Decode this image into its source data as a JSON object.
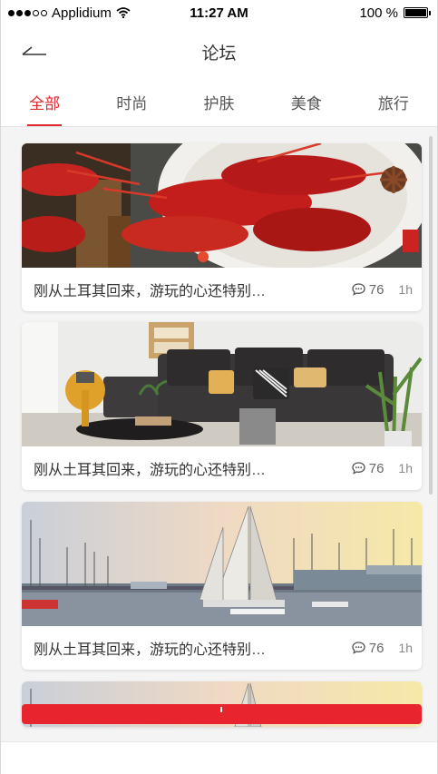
{
  "status_bar": {
    "carrier": "Applidium",
    "time": "11:27 AM",
    "battery": "100 %",
    "icons": [
      "signal-dots-icon",
      "wifi-icon",
      "battery-icon"
    ]
  },
  "nav": {
    "title": "论坛",
    "back_icon": "back-arrow-icon"
  },
  "tabs": [
    {
      "label": "全部",
      "active": true
    },
    {
      "label": "时尚",
      "active": false
    },
    {
      "label": "护肤",
      "active": false
    },
    {
      "label": "美食",
      "active": false
    },
    {
      "label": "旅行",
      "active": false
    }
  ],
  "posts": [
    {
      "title": "刚从土耳其回来，游玩的心还特别…",
      "comments": "76",
      "time": "1h",
      "image": "crayfish-dish-photo"
    },
    {
      "title": "刚从土耳其回来，游玩的心还特别…",
      "comments": "76",
      "time": "1h",
      "image": "living-room-sofa-photo"
    },
    {
      "title": "刚从土耳其回来，游玩的心还特别…",
      "comments": "76",
      "time": "1h",
      "image": "sailboat-harbor-photo"
    }
  ],
  "colors": {
    "accent": "#e0282f",
    "cta": "#e8242f"
  }
}
